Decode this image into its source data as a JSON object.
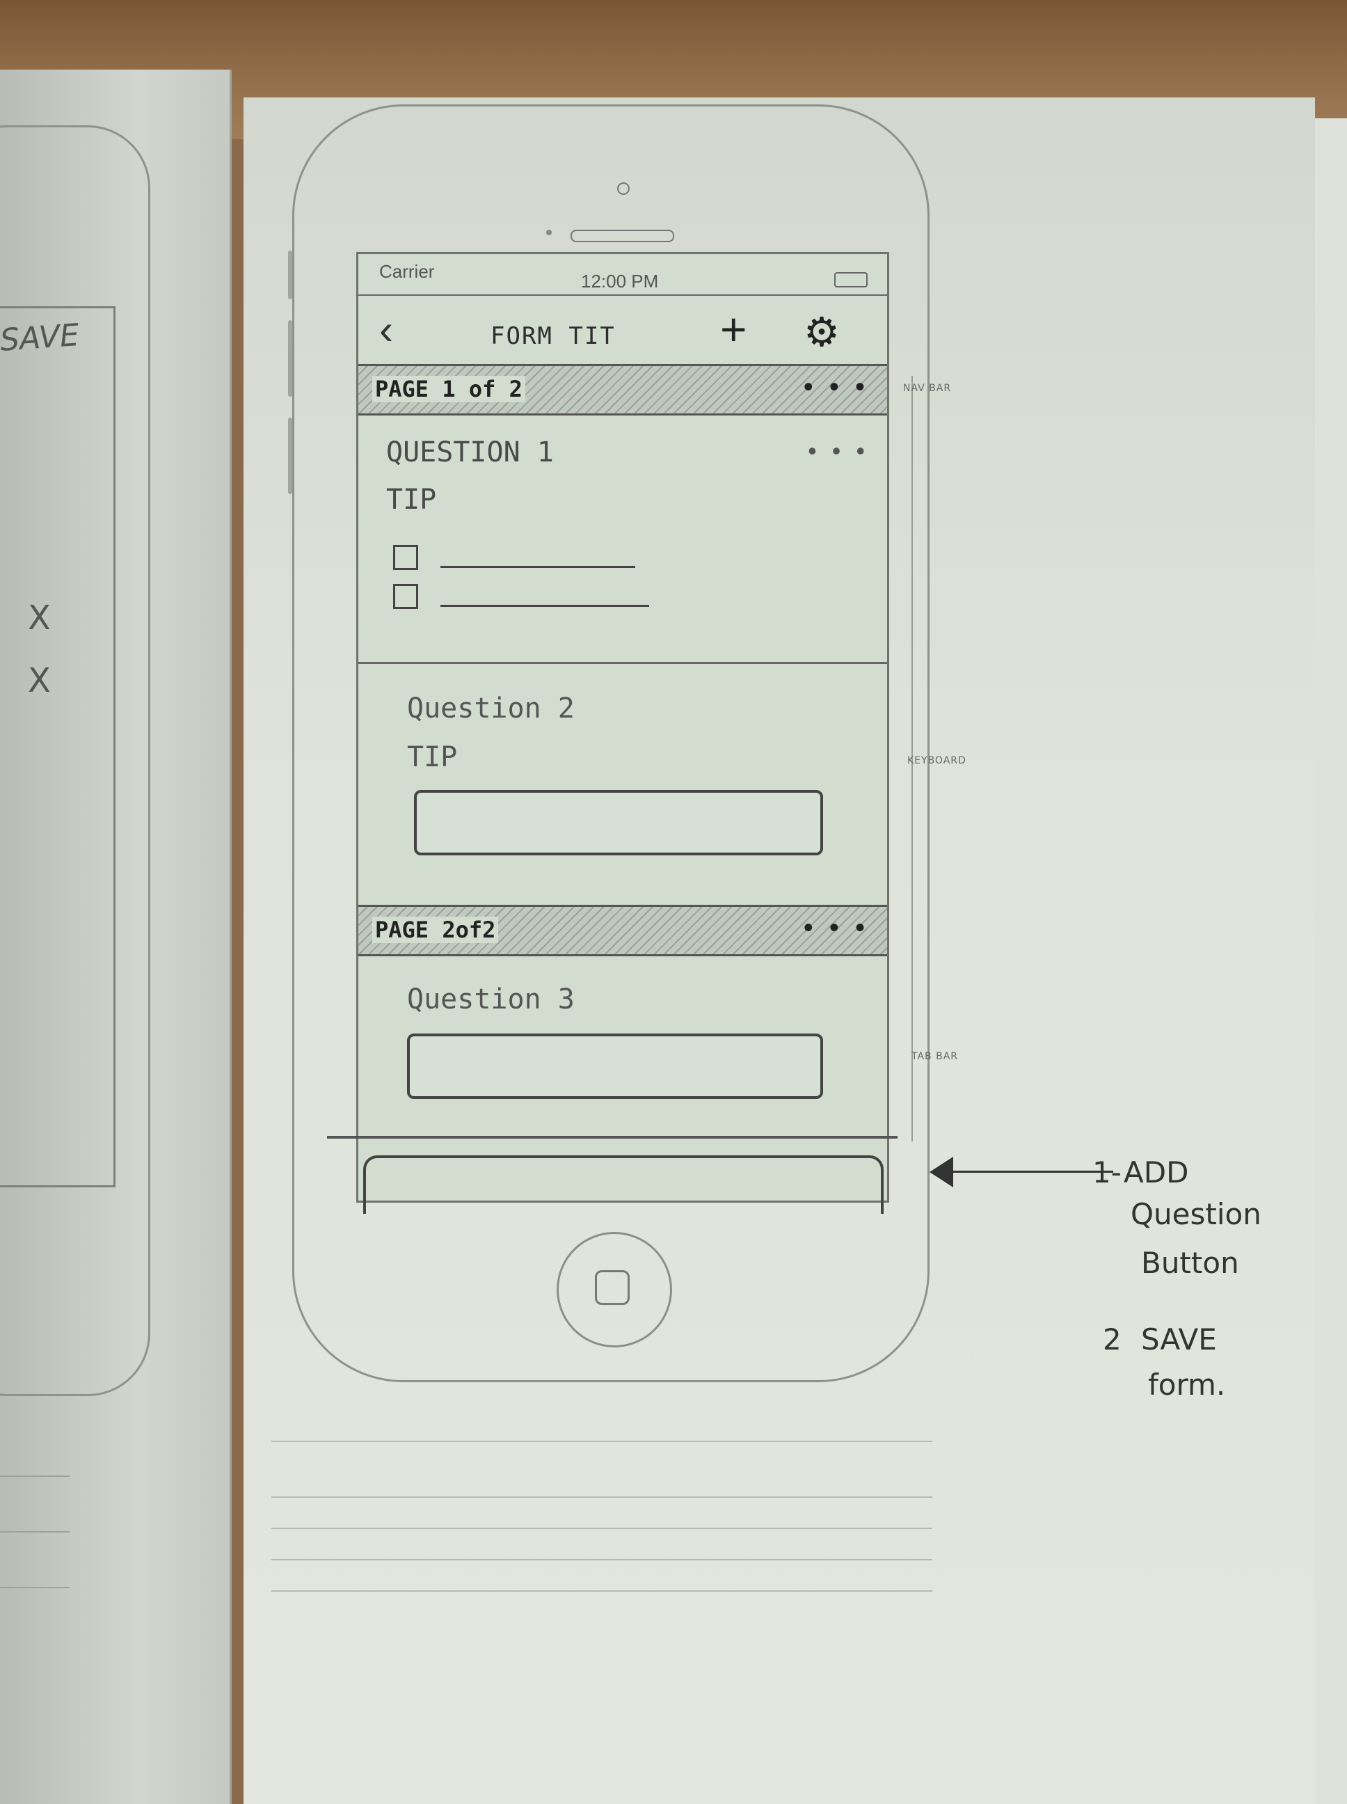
{
  "left_sketch": {
    "save_label": "SAVE",
    "x_marks": [
      "X",
      "X"
    ]
  },
  "phone": {
    "status_bar": {
      "carrier": "Carrier",
      "time": "12:00 PM"
    },
    "nav_bar": {
      "back_icon": "chevron-left-icon",
      "title": "FORM TIT",
      "add_icon": "plus-icon",
      "add_glyph": "+",
      "settings_icon": "gear-icon",
      "settings_glyph": "⚙"
    },
    "pages": [
      {
        "label": "PAGE 1 of 2",
        "menu": "• • •",
        "questions": [
          {
            "title": "QUESTION 1",
            "tip": "TIP",
            "menu": "• • •",
            "type": "checkbox"
          },
          {
            "title": "Question 2",
            "tip": "TIP",
            "type": "text-field"
          }
        ]
      },
      {
        "label": "PAGE 2of2",
        "menu": "• • •",
        "questions": [
          {
            "title": "Question 3",
            "type": "text-field"
          }
        ]
      }
    ]
  },
  "margin_labels": {
    "nav_bar": "NAV BAR",
    "keyboard": "KEYBOARD",
    "tab_bar": "TAB BAR"
  },
  "annotation": {
    "item_1_num": "1-",
    "item_1_line_1": "ADD",
    "item_1_line_2": "Question",
    "item_1_line_3": "Button",
    "item_2_num": "2",
    "item_2_line_1": "SAVE",
    "item_2_line_2": "form."
  }
}
